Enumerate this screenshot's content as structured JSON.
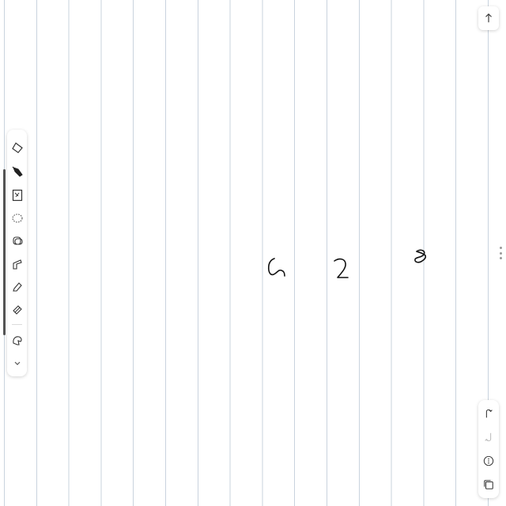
{
  "canvas": {
    "handwritten_digits": [
      "5",
      "2",
      "8"
    ],
    "line_color": "#c9d3de"
  },
  "toolbar": {
    "tools": [
      {
        "name": "eraser-icon"
      },
      {
        "name": "pen-icon",
        "active": true
      },
      {
        "name": "text-box-icon"
      },
      {
        "name": "lasso-icon"
      },
      {
        "name": "shape-icon"
      },
      {
        "name": "ruler-icon"
      },
      {
        "name": "highlighter-icon"
      },
      {
        "name": "marker-icon"
      },
      {
        "name": "pointer-icon"
      },
      {
        "name": "chevron-down-icon"
      }
    ]
  },
  "right_controls": [
    "undo-icon",
    "redo-icon",
    "more-icon",
    "pages-icon"
  ],
  "top_right": "arrow-up-icon"
}
